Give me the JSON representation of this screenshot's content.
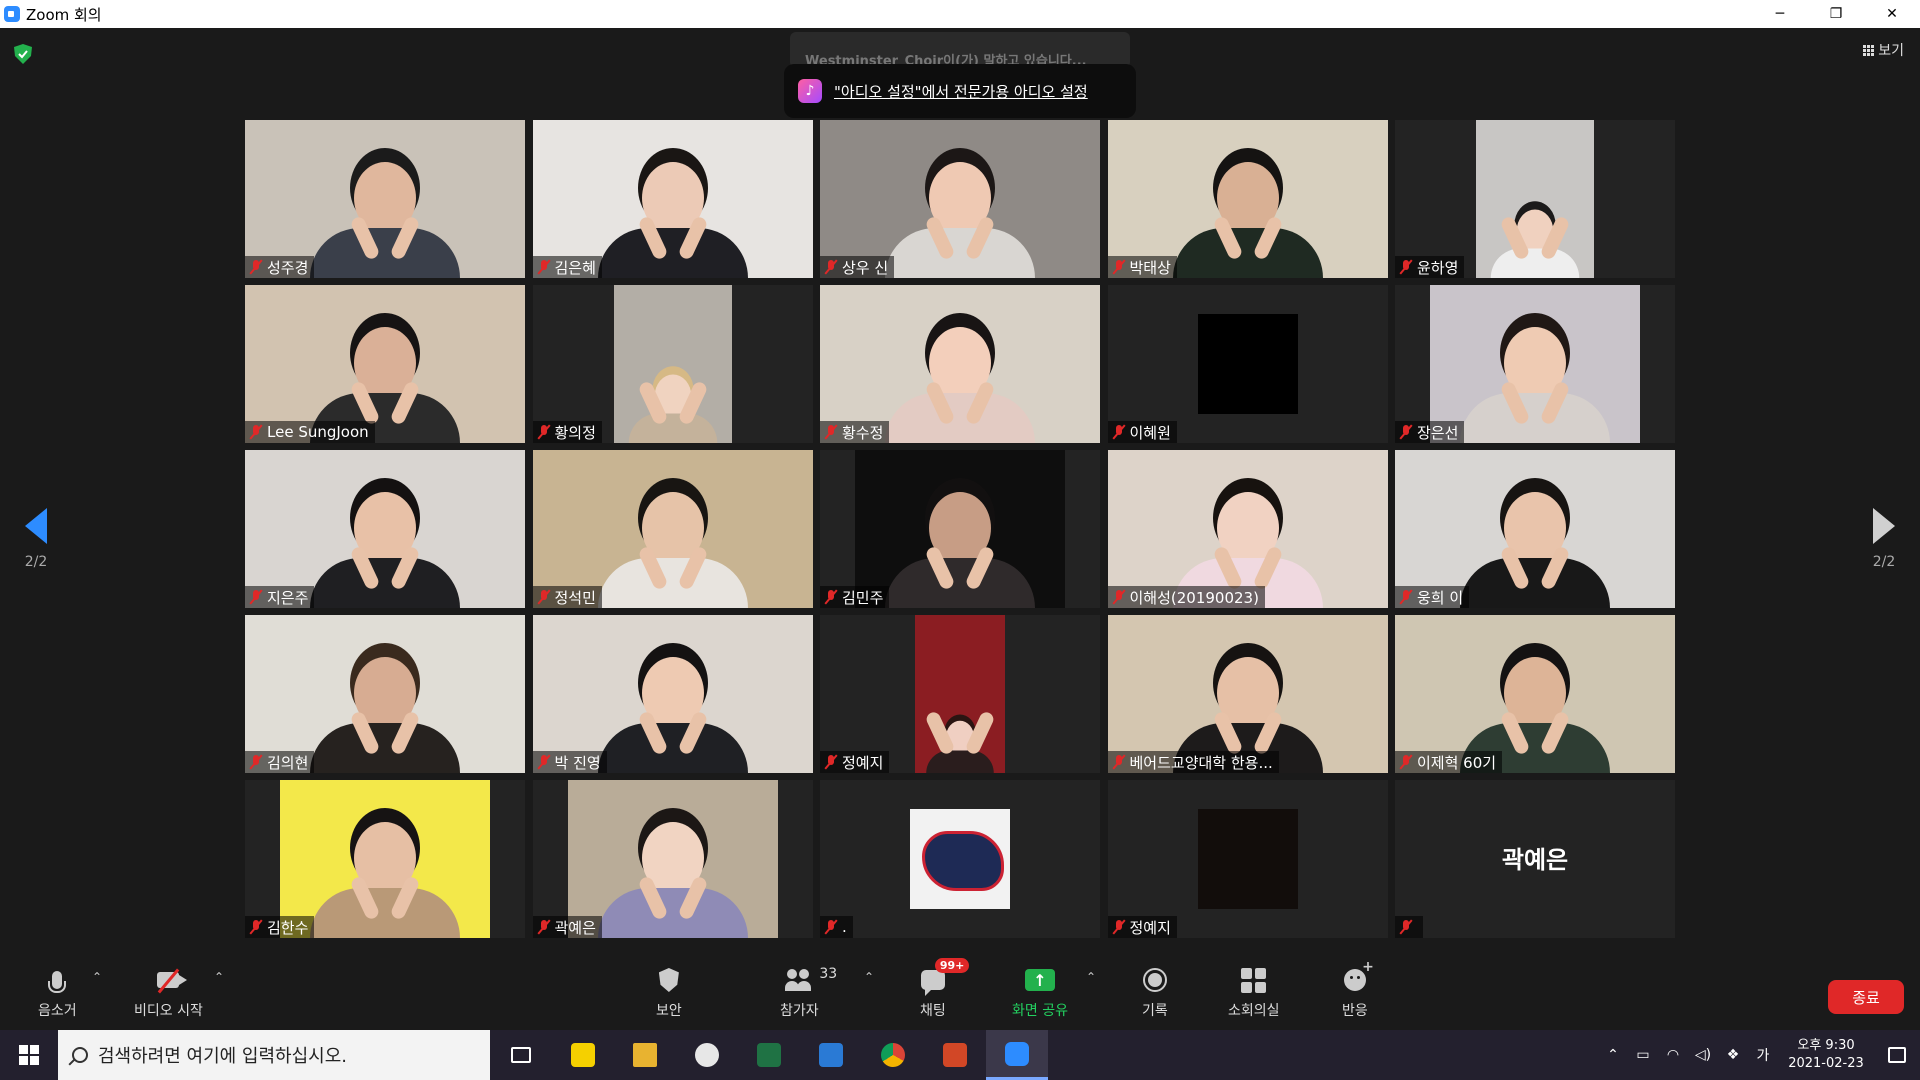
{
  "window": {
    "title": "Zoom 회의",
    "controls": [
      "─",
      "❐",
      "✕"
    ]
  },
  "header": {
    "view_label": "보기"
  },
  "notification": {
    "ghost_text": "Westminster_Choir이(가) 말하고 있습니다...",
    "message": "\"아디오 설정\"에서 전문가용 아디오 설정"
  },
  "pager": {
    "left_label": "2/2",
    "right_label": "2/2"
  },
  "tiles": [
    {
      "name": "성주경",
      "bg": "#c9c2b8",
      "skin": "#e0b79d",
      "shirt": "#3a3f4a",
      "hair": "#1b1b1b",
      "w": 280
    },
    {
      "name": "김은혜",
      "bg": "#e7e4e1",
      "skin": "#eccab6",
      "shirt": "#1f1f24",
      "hair": "#1a1614",
      "w": 280
    },
    {
      "name": "상우 신",
      "bg": "#8f8a86",
      "skin": "#efc9b3",
      "shirt": "#d9d6d2",
      "hair": "#1c1716",
      "w": 280
    },
    {
      "name": "박태상",
      "bg": "#d8d0bf",
      "skin": "#d9b094",
      "shirt": "#1f2a22",
      "hair": "#151312",
      "w": 280
    },
    {
      "name": "윤하영",
      "bg": "#c8c6c4",
      "skin": "#f0d1bf",
      "shirt": "#eeeeee",
      "hair": "#1c1a1a",
      "w": 118
    },
    {
      "name": "Lee SungJoon",
      "bg": "#d2c3b0",
      "skin": "#dab097",
      "shirt": "#2b2b2b",
      "hair": "#161313",
      "w": 280
    },
    {
      "name": "황의정",
      "bg": "#b3aea6",
      "skin": "#f0d3c0",
      "shirt": "#c4b29b",
      "hair": "#d6b985",
      "w": 118
    },
    {
      "name": "황수정",
      "bg": "#d8d1c6",
      "skin": "#f3cfbb",
      "shirt": "#e3cbc3",
      "hair": "#181414",
      "w": 280
    },
    {
      "name": "이혜원",
      "bg": "#232323",
      "box": "black"
    },
    {
      "name": "장은선",
      "bg": "#c9c4ca",
      "skin": "#efcbb3",
      "shirt": "#d6d0cc",
      "hair": "#201815",
      "w": 210
    },
    {
      "name": "지은주",
      "bg": "#d9d5d1",
      "skin": "#e8c1a7",
      "shirt": "#1f1f22",
      "hair": "#141111",
      "w": 280
    },
    {
      "name": "정석민",
      "bg": "#c8b492",
      "skin": "#e6c3a8",
      "shirt": "#e8e4df",
      "hair": "#181512",
      "w": 280
    },
    {
      "name": "김민주",
      "bg": "#0e0e0e",
      "skin": "#c79d85",
      "shirt": "#2f2a2b",
      "hair": "#121010",
      "w": 210
    },
    {
      "name": "이해성(20190023)",
      "bg": "#ddd3c9",
      "skin": "#f1d2c2",
      "shirt": "#f0d9e0",
      "hair": "#17120f",
      "w": 280
    },
    {
      "name": "웅희 이",
      "bg": "#d8d6d3",
      "skin": "#e9c4ab",
      "shirt": "#181818",
      "hair": "#171412",
      "w": 280
    },
    {
      "name": "김의현",
      "bg": "#e0ddd6",
      "skin": "#d7ac92",
      "shirt": "#26221f",
      "hair": "#3a2a1e",
      "w": 280
    },
    {
      "name": "박 진영",
      "bg": "#dcd6cf",
      "skin": "#eecab2",
      "shirt": "#1f2024",
      "hair": "#141212",
      "w": 280
    },
    {
      "name": "정예지",
      "bg": "#8b1d22",
      "skin": "#f0cfc2",
      "shirt": "#2a1d1d",
      "hair": "#2a1512",
      "w": 90
    },
    {
      "name": "베어드교양대학 한용...",
      "bg": "#d4c6b0",
      "skin": "#e6c0a6",
      "shirt": "#1d1b1b",
      "hair": "#161311",
      "w": 280
    },
    {
      "name": "이제혁 60기",
      "bg": "#cfc6b2",
      "skin": "#ddb497",
      "shirt": "#2e3d33",
      "hair": "#141212",
      "w": 280
    },
    {
      "name": "김한수",
      "bg": "#f3e84a",
      "skin": "#e6bfa4",
      "shirt": "#b99977",
      "hair": "#161313",
      "w": 210
    },
    {
      "name": "곽예은",
      "bg": "#b9ac98",
      "skin": "#f1d4c2",
      "shirt": "#8f8bb6",
      "hair": "#1c1715",
      "w": 210
    },
    {
      "name": ".",
      "bg": "#232323",
      "box": "glove"
    },
    {
      "name": "정예지",
      "bg": "#232323",
      "box": "dark"
    },
    {
      "name": "",
      "bg": "#232323",
      "box": "text",
      "center_text": "곽예은"
    }
  ],
  "toolbar": {
    "mute_label": "음소거",
    "video_label": "비디오 시작",
    "security_label": "보안",
    "participants_label": "참가자",
    "participants_count": "33",
    "chat_label": "채팅",
    "chat_badge": "99+",
    "share_label": "화면 공유",
    "record_label": "기록",
    "breakout_label": "소회의실",
    "reactions_label": "반응",
    "end_label": "종료"
  },
  "taskbar": {
    "search_placeholder": "검색하려면 여기에 입력하십시오.",
    "apps": [
      "task-view",
      "sticky-notes",
      "file-explorer",
      "paint",
      "excel",
      "browser-e",
      "chrome",
      "powerpoint",
      "zoom"
    ],
    "ime": "가",
    "time": "오후 9:30",
    "date": "2021-02-23"
  },
  "colors": {
    "accent": "#2d8cff",
    "end": "#e02828",
    "share": "#23b14d"
  }
}
